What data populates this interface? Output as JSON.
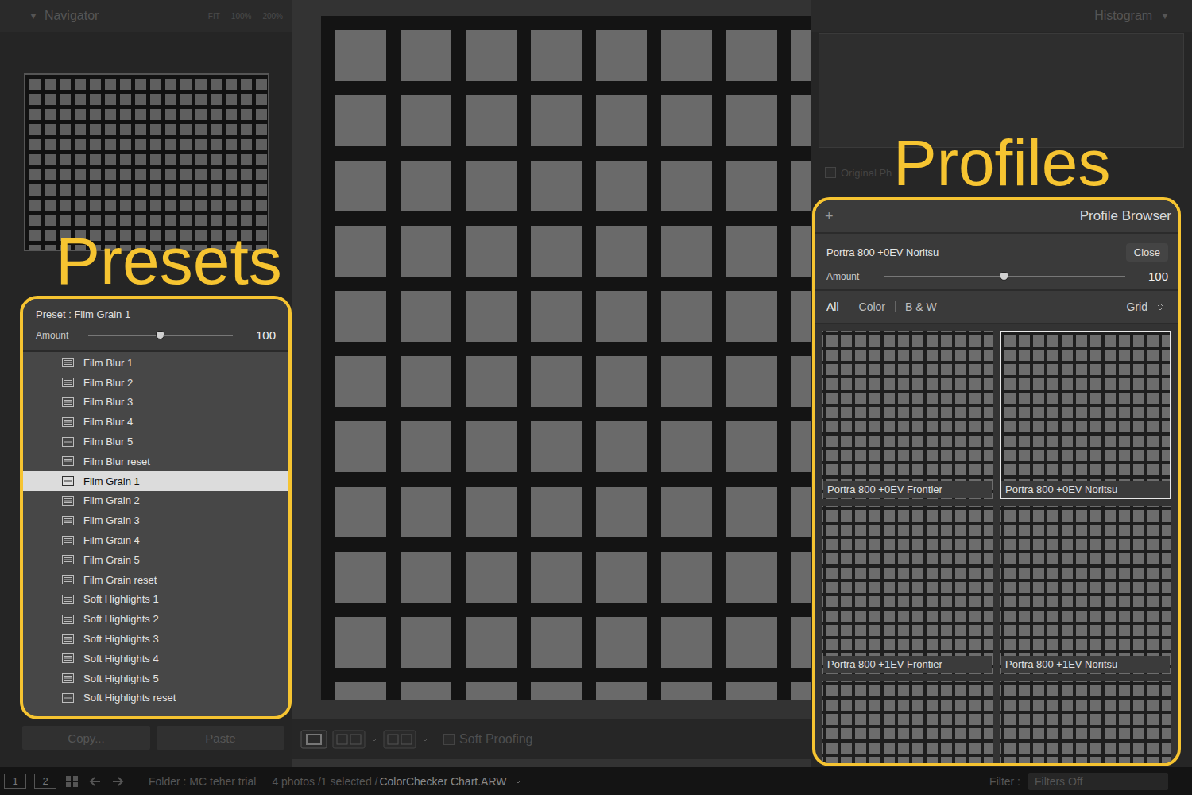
{
  "navigator": {
    "collapse": "▼",
    "title": "Navigator",
    "zoom": [
      "FIT",
      "100%",
      "200%"
    ]
  },
  "overlays": {
    "presets": "Presets",
    "profiles": "Profiles"
  },
  "presets": {
    "label": "Preset : Film Grain 1",
    "amount": {
      "label": "Amount",
      "level": 0.5,
      "reading": "100"
    },
    "items": [
      {
        "name": "Film Blur 1",
        "selected": false
      },
      {
        "name": "Film Blur 2",
        "selected": false
      },
      {
        "name": "Film Blur 3",
        "selected": false
      },
      {
        "name": "Film Blur 4",
        "selected": false
      },
      {
        "name": "Film Blur 5",
        "selected": false
      },
      {
        "name": "Film Blur reset",
        "selected": false
      },
      {
        "name": "Film Grain 1",
        "selected": true
      },
      {
        "name": "Film Grain 2",
        "selected": false
      },
      {
        "name": "Film Grain 3",
        "selected": false
      },
      {
        "name": "Film Grain 4",
        "selected": false
      },
      {
        "name": "Film Grain 5",
        "selected": false
      },
      {
        "name": "Film Grain reset",
        "selected": false
      },
      {
        "name": "Soft Highlights 1",
        "selected": false
      },
      {
        "name": "Soft Highlights 2",
        "selected": false
      },
      {
        "name": "Soft Highlights 3",
        "selected": false
      },
      {
        "name": "Soft Highlights 4",
        "selected": false
      },
      {
        "name": "Soft Highlights 5",
        "selected": false
      },
      {
        "name": "Soft Highlights reset",
        "selected": false
      }
    ]
  },
  "panel_buttons": [
    "Copy...",
    "Paste"
  ],
  "histogram": {
    "title": "Histogram",
    "collapse": "▼",
    "original_photo": {
      "label": "Original Ph",
      "checked": false
    }
  },
  "profile_browser": {
    "add": "+",
    "title": "Profile Browser",
    "current": "Portra 800 +0EV Noritsu",
    "close": "Close",
    "amount": {
      "label": "Amount",
      "level": 0.5,
      "reading": "100"
    },
    "filters": [
      {
        "label": "All",
        "selected": true
      },
      {
        "label": "Color",
        "selected": false
      },
      {
        "label": "B & W",
        "selected": false
      }
    ],
    "view": "Grid",
    "profiles": [
      {
        "kind": "labeled",
        "name": "Portra 800 +0EV Frontier",
        "selected": false
      },
      {
        "kind": "labeled",
        "name": "Portra 800 +0EV Noritsu",
        "selected": true
      },
      {
        "kind": "labeled",
        "name": "Portra 800 +1EV Frontier",
        "selected": false
      },
      {
        "kind": "labeled",
        "name": "Portra 800 +1EV Noritsu",
        "selected": false
      },
      {
        "kind": "partial",
        "name": "",
        "selected": false
      },
      {
        "kind": "partial",
        "name": "",
        "selected": false
      }
    ]
  },
  "toolbar": {
    "soft_proofing": {
      "label": "Soft Proofing",
      "checked": false
    }
  },
  "filmstrip_bar": {
    "pages": [
      "1",
      "2"
    ],
    "folder": "Folder : MC teher trial",
    "info": "4 photos /1 selected /",
    "file": "ColorChecker Chart.ARW",
    "filter_label": "Filter :",
    "filter_value": "Filters Off"
  }
}
